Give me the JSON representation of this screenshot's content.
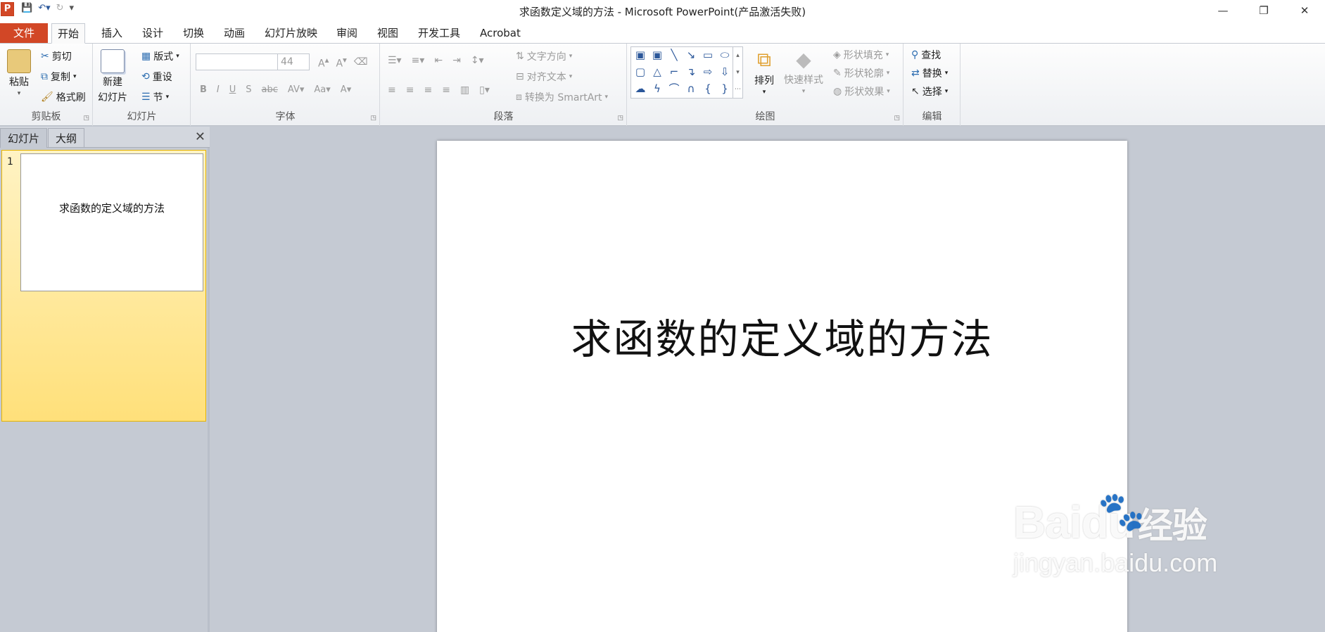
{
  "window": {
    "title": "求函数定义域的方法 - Microsoft PowerPoint(产品激活失败)",
    "app_icon": "P",
    "controls": {
      "minimize": "—",
      "restore": "❐",
      "close": "✕"
    }
  },
  "quick_access": {
    "save": "save-icon",
    "undo": "undo-icon",
    "redo": "redo-icon"
  },
  "tabs": {
    "file": "文件",
    "items": [
      "开始",
      "插入",
      "设计",
      "切换",
      "动画",
      "幻灯片放映",
      "审阅",
      "视图",
      "开发工具",
      "Acrobat"
    ]
  },
  "ribbon": {
    "clipboard": {
      "label": "剪贴板",
      "paste": "粘贴",
      "cut": "剪切",
      "copy": "复制",
      "format_painter": "格式刷"
    },
    "slides": {
      "label": "幻灯片",
      "new_slide_line1": "新建",
      "new_slide_line2": "幻灯片",
      "layout": "版式",
      "reset": "重设",
      "section": "节"
    },
    "font": {
      "label": "字体",
      "font_name": "",
      "font_size": "44"
    },
    "paragraph": {
      "label": "段落",
      "text_direction": "文字方向",
      "align_text": "对齐文本",
      "convert_smartart": "转换为 SmartArt"
    },
    "drawing": {
      "label": "绘图",
      "arrange": "排列",
      "quick_styles": "快速样式",
      "shape_fill": "形状填充",
      "shape_outline": "形状轮廓",
      "shape_effects": "形状效果"
    },
    "editing": {
      "label": "编辑",
      "find": "查找",
      "replace": "替换",
      "select": "选择"
    }
  },
  "left_pane": {
    "tab_slides": "幻灯片",
    "tab_outline": "大纲",
    "close": "✕",
    "thumbnail": {
      "number": "1",
      "title": "求函数的定义域的方法"
    }
  },
  "slide": {
    "title": "求函数的定义域的方法"
  },
  "watermark": {
    "brand": "Bai",
    "brand2": "du",
    "brand_cn": "经验",
    "url": "jingyan.baidu.com"
  },
  "colors": {
    "file_tab": "#d24726",
    "accent": "#2b579a",
    "thumb_selected": "#ffe07a"
  }
}
